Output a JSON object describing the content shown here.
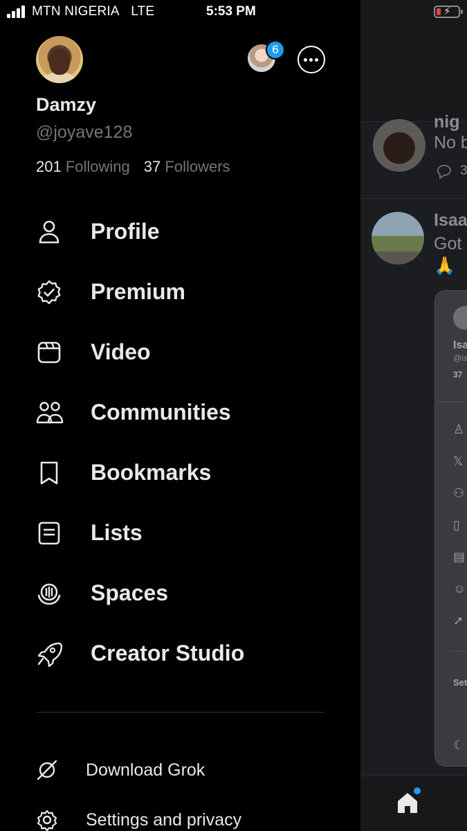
{
  "status_bar": {
    "carrier": "MTN NIGERIA",
    "network": "LTE",
    "time": "5:53 PM"
  },
  "account": {
    "name": "Damzy",
    "handle": "@joyave128",
    "following_count": "201",
    "following_label": "Following",
    "followers_count": "37",
    "followers_label": "Followers",
    "switcher_badge": "6"
  },
  "menu": [
    {
      "label": "Profile",
      "icon": "person-icon"
    },
    {
      "label": "Premium",
      "icon": "verified-badge-icon"
    },
    {
      "label": "Video",
      "icon": "video-icon"
    },
    {
      "label": "Communities",
      "icon": "communities-icon"
    },
    {
      "label": "Bookmarks",
      "icon": "bookmark-icon"
    },
    {
      "label": "Lists",
      "icon": "list-icon"
    },
    {
      "label": "Spaces",
      "icon": "spaces-icon"
    },
    {
      "label": "Creator Studio",
      "icon": "rocket-icon"
    }
  ],
  "secondary_menu": [
    {
      "label": "Download Grok",
      "icon": "grok-icon"
    },
    {
      "label": "Settings and privacy",
      "icon": "gear-icon"
    }
  ],
  "background_timeline": {
    "post1_name": "nig",
    "post1_text": "No b",
    "post1_reply_count": "3",
    "post2_name": "Isaa",
    "post2_text": "Got",
    "post2_emoji": "🙏",
    "card_name": "Isa",
    "card_handle": "@is",
    "card_count": "37",
    "card_settings": "Set"
  },
  "colors": {
    "accent": "#1d9bf0",
    "text_primary": "#e7e9ea",
    "text_secondary": "#71767b",
    "background": "#000000"
  }
}
